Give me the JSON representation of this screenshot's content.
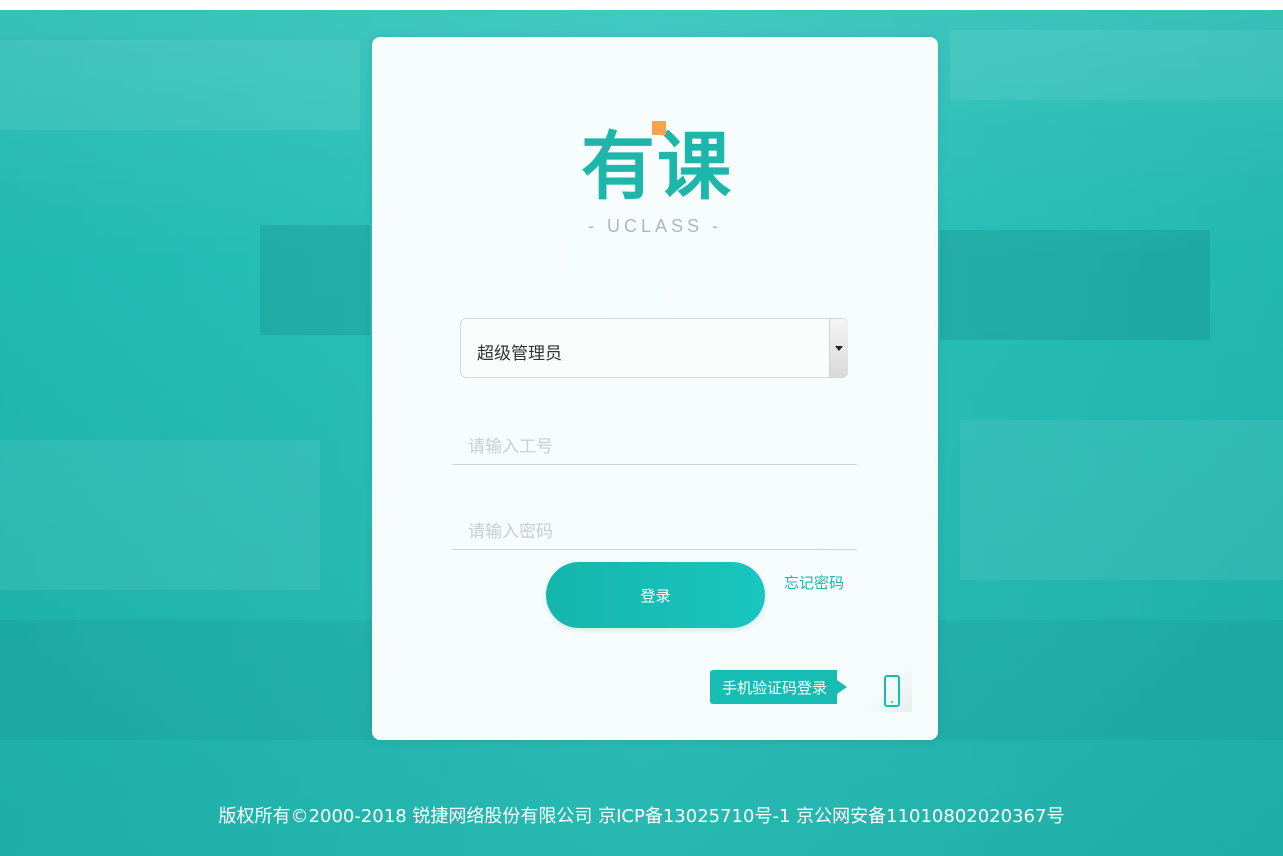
{
  "logo": {
    "text": "有课",
    "subtitle": "- UCLASS -"
  },
  "login_form": {
    "role_select_value": "超级管理员",
    "employee_id_placeholder": "请输入工号",
    "password_placeholder": "请输入密码",
    "login_button_label": "登录",
    "forgot_password_label": "忘记密码",
    "sms_login_label": "手机验证码登录"
  },
  "footer": {
    "copyright": "版权所有©2000-2018 锐捷网络股份有限公司 京ICP备13025710号-1 京公网安备11010802020367号"
  },
  "colors": {
    "accent": "#1cb6ab",
    "background": "#20bcb3",
    "logo_dot": "#f6a44c"
  },
  "icons": {
    "dropdown": "chevron-down-icon",
    "phone": "mobile-phone-icon"
  }
}
